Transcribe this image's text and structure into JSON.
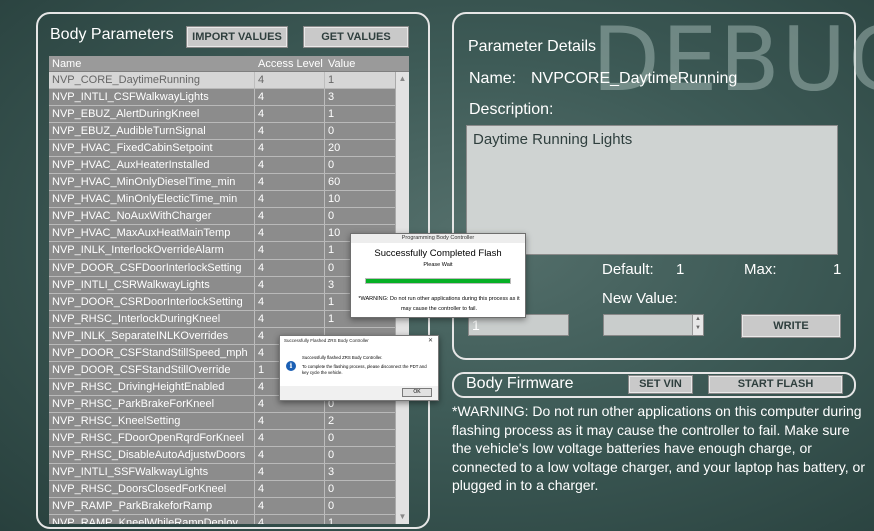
{
  "body_params": {
    "title": "Body Parameters",
    "import_label": "IMPORT VALUES",
    "get_label": "GET VALUES",
    "columns": {
      "name": "Name",
      "access": "Access Level",
      "value": "Value"
    },
    "rows": [
      {
        "name": "NVP_CORE_DaytimeRunning",
        "access": "4",
        "value": "1"
      },
      {
        "name": "NVP_INTLI_CSFWalkwayLights",
        "access": "4",
        "value": "3"
      },
      {
        "name": "NVP_EBUZ_AlertDuringKneel",
        "access": "4",
        "value": "1"
      },
      {
        "name": "NVP_EBUZ_AudibleTurnSignal",
        "access": "4",
        "value": "0"
      },
      {
        "name": "NVP_HVAC_FixedCabinSetpoint",
        "access": "4",
        "value": "20"
      },
      {
        "name": "NVP_HVAC_AuxHeaterInstalled",
        "access": "4",
        "value": "0"
      },
      {
        "name": "NVP_HVAC_MinOnlyDieselTime_min",
        "access": "4",
        "value": "60"
      },
      {
        "name": "NVP_HVAC_MinOnlyElecticTime_min",
        "access": "4",
        "value": "10"
      },
      {
        "name": "NVP_HVAC_NoAuxWithCharger",
        "access": "4",
        "value": "0"
      },
      {
        "name": "NVP_HVAC_MaxAuxHeatMainTemp",
        "access": "4",
        "value": "10"
      },
      {
        "name": "NVP_INLK_InterlockOverrideAlarm",
        "access": "4",
        "value": "1"
      },
      {
        "name": "NVP_DOOR_CSFDoorInterlockSetting",
        "access": "4",
        "value": "0"
      },
      {
        "name": "NVP_INTLI_CSRWalkwayLights",
        "access": "4",
        "value": "3"
      },
      {
        "name": "NVP_DOOR_CSRDoorInterlockSetting",
        "access": "4",
        "value": "1"
      },
      {
        "name": "NVP_RHSC_InterlockDuringKneel",
        "access": "4",
        "value": "1"
      },
      {
        "name": "NVP_INLK_SeparateINLKOverrides",
        "access": "4",
        "value": ""
      },
      {
        "name": "NVP_DOOR_CSFStandStillSpeed_mph",
        "access": "4",
        "value": ""
      },
      {
        "name": "NVP_DOOR_CSFStandStillOverride",
        "access": "1",
        "value": ""
      },
      {
        "name": "NVP_RHSC_DrivingHeightEnabled",
        "access": "4",
        "value": ""
      },
      {
        "name": "NVP_RHSC_ParkBrakeForKneel",
        "access": "4",
        "value": "0"
      },
      {
        "name": "NVP_RHSC_KneelSetting",
        "access": "4",
        "value": "2"
      },
      {
        "name": "NVP_RHSC_FDoorOpenRqrdForKneel",
        "access": "4",
        "value": "0"
      },
      {
        "name": "NVP_RHSC_DisableAutoAdjustwDoors",
        "access": "4",
        "value": "0"
      },
      {
        "name": "NVP_INTLI_SSFWalkwayLights",
        "access": "4",
        "value": "3"
      },
      {
        "name": "NVP_RHSC_DoorsClosedForKneel",
        "access": "4",
        "value": "0"
      },
      {
        "name": "NVP_RAMP_ParkBrakeforRamp",
        "access": "4",
        "value": "0"
      },
      {
        "name": "NVP_RAMP_KneelWhileRampDeploy",
        "access": "4",
        "value": "1"
      }
    ]
  },
  "details": {
    "title": "Parameter Details",
    "watermark": "DEBUG",
    "name_label": "Name:",
    "name_value": "NVPCORE_DaytimeRunning",
    "description_label": "Description:",
    "description_text": "Daytime Running Lights",
    "default_label": "Default:",
    "default_value": "1",
    "max_label": "Max:",
    "max_value": "1",
    "current_value": "1",
    "new_value_label": "New Value:",
    "new_value": "",
    "write_label": "WRITE"
  },
  "firmware": {
    "title": "Body Firmware",
    "set_vin_label": "SET VIN",
    "start_flash_label": "START FLASH",
    "warning": "*WARNING: Do not run other applications on this computer during flashing process as it may cause the controller to fail. Make sure the vehicle's low voltage batteries have enough charge, or connected to a low voltage charger, and your laptop has battery, or plugged in to a charger."
  },
  "flash_dialog": {
    "title": "Programming Body Controller",
    "heading": "Successfully Completed Flash",
    "status": "Please Wait",
    "progress": 1.0,
    "warning": "*WARNING: Do not run other applications during this process as it may cause the controller to fail."
  },
  "message_box": {
    "title": "Successfully Flashed ZRS Body Controller",
    "line1": "Successfully flashed ZRS Body Controller.",
    "line2": "To complete the flashing process, please disconnect the PDT and key cycle the vehicle.",
    "ok_label": "OK",
    "close_glyph": "✕"
  },
  "colors": {
    "progress_fill": "#06b025",
    "background": "#3d5a56"
  }
}
